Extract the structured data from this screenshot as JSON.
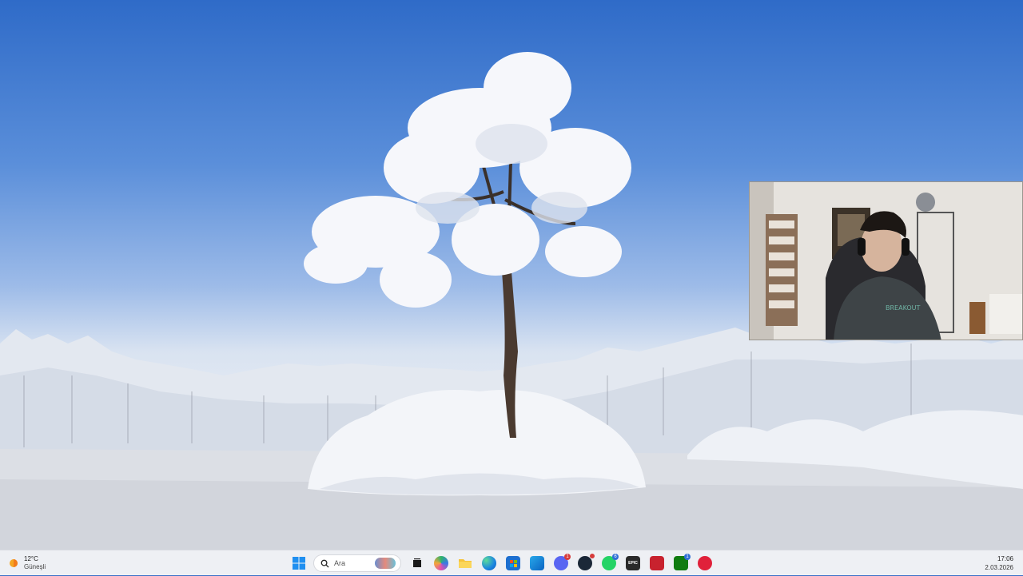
{
  "taskbar": {
    "weather": {
      "temperature": "12°C",
      "condition": "Güneşli",
      "icon": "sun-icon"
    },
    "search": {
      "placeholder": "Ara"
    },
    "apps": [
      {
        "name": "windows-start",
        "icon": "windows-logo-icon"
      },
      {
        "name": "search",
        "icon": "search-icon"
      },
      {
        "name": "task-view",
        "icon": "task-view-icon"
      },
      {
        "name": "copilot",
        "icon": "copilot-icon"
      },
      {
        "name": "file-explorer",
        "icon": "folder-icon"
      },
      {
        "name": "edge",
        "icon": "edge-icon"
      },
      {
        "name": "microsoft-store",
        "icon": "store-icon"
      },
      {
        "name": "outlook",
        "icon": "outlook-icon"
      },
      {
        "name": "discord",
        "icon": "discord-icon",
        "badge": "1"
      },
      {
        "name": "steam",
        "icon": "steam-icon"
      },
      {
        "name": "whatsapp",
        "icon": "whatsapp-icon",
        "badge": "6"
      },
      {
        "name": "epic-games",
        "icon": "epic-games-icon",
        "label": "EPIC"
      },
      {
        "name": "riot-client",
        "icon": "riot-icon"
      },
      {
        "name": "xbox",
        "icon": "xbox-icon",
        "badge": "1"
      },
      {
        "name": "app-red",
        "icon": "red-app-icon"
      }
    ],
    "clock": {
      "time": "17:06",
      "date": "2.03.2026"
    }
  },
  "colors": {
    "taskbar_bg": "#eef0f4",
    "sky_top": "#2f6bc8",
    "snow": "#e9edf3"
  }
}
